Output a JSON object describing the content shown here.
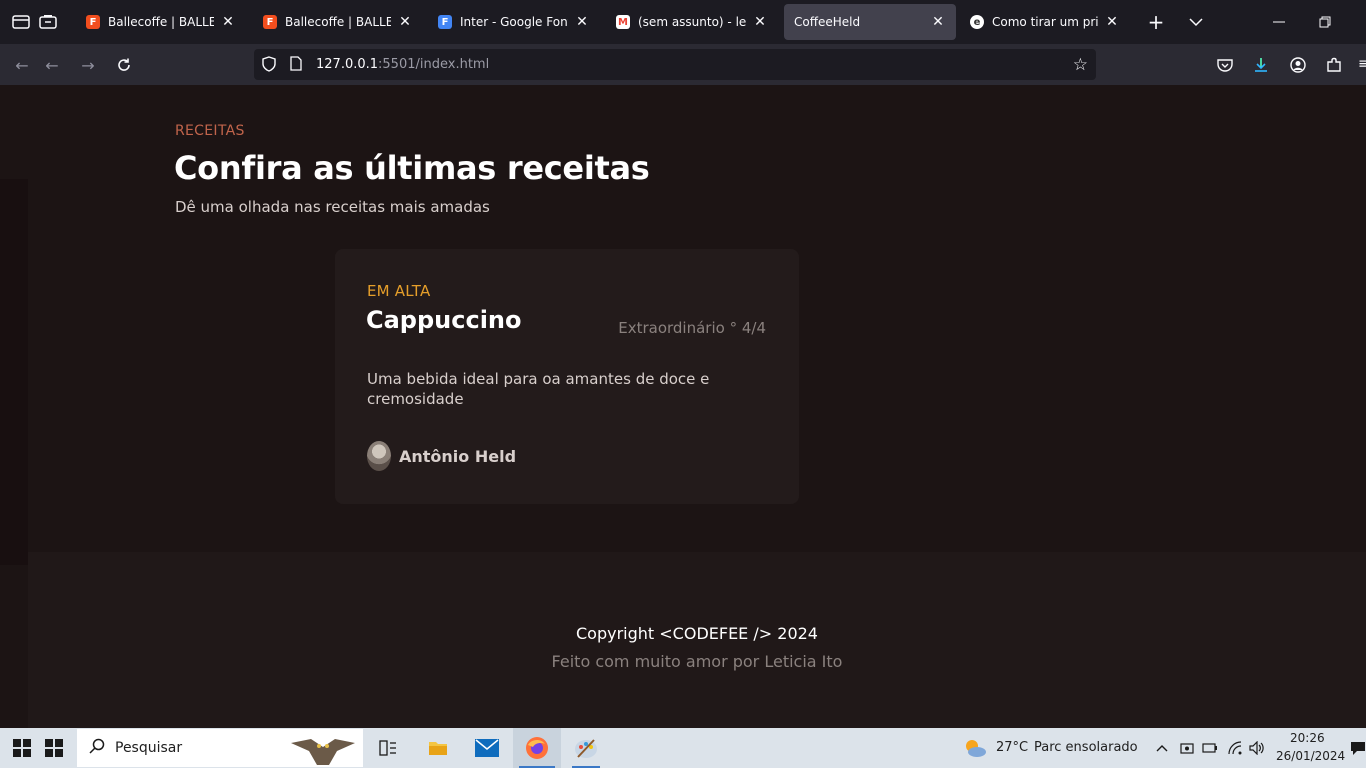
{
  "browser": {
    "tabs": [
      {
        "title": "Ballecoffe | BALLERINI",
        "icon": "figma-icon",
        "active": false
      },
      {
        "title": "Ballecoffe | BALLERINI",
        "icon": "figma-icon",
        "active": false
      },
      {
        "title": "Inter - Google Fonts",
        "icon": "google-fonts-icon",
        "active": false
      },
      {
        "title": "(sem assunto) - leticia",
        "icon": "gmail-icon",
        "active": false
      },
      {
        "title": "CoffeeHeld",
        "icon": "",
        "active": true
      },
      {
        "title": "Como tirar um print sc",
        "icon": "edge-icon",
        "active": false
      }
    ],
    "url_host": "127.0.0.1",
    "url_rest": ":5501/index.html"
  },
  "page": {
    "section_label": "RECEITAS",
    "section_title": "Confira as últimas receitas",
    "section_subtitle": "Dê uma olhada nas receitas mais amadas",
    "card": {
      "badge": "EM ALTA",
      "title": "Cappuccino",
      "rating": "Extraordinário ° 4/4",
      "description": "Uma bebida ideal para oa amantes de doce e cremosidade",
      "author": "Antônio Held"
    },
    "footer": {
      "copyright": "Copyright <CODEFEE /> 2024",
      "made_by": "Feito com muito amor por Leticia Ito"
    }
  },
  "taskbar": {
    "search_placeholder": "Pesquisar",
    "weather_temp": "27°C",
    "weather_desc": "Parc ensolarado",
    "time": "20:26",
    "date": "26/01/2024"
  },
  "colors": {
    "accent_label": "#c0644b",
    "badge": "#e59e2a",
    "page_bg": "#1c1414"
  }
}
